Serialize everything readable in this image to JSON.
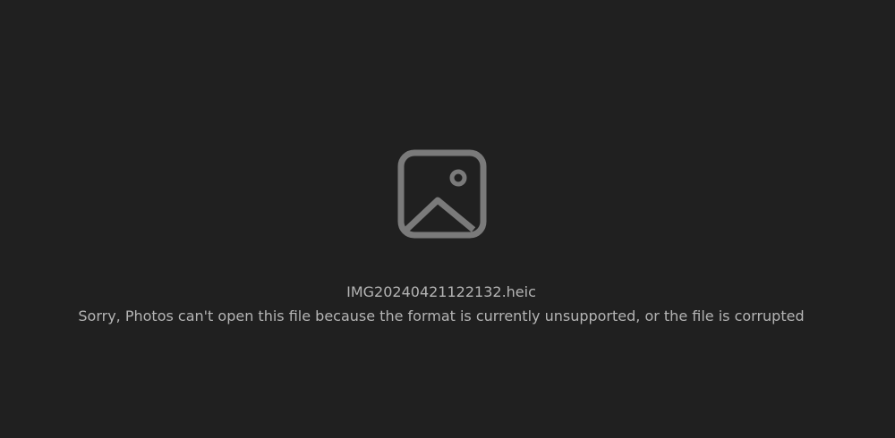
{
  "viewer": {
    "icon": "image-placeholder-icon",
    "filename": "IMG20240421122132.heic",
    "message": "Sorry, Photos can't open this file because the format is currently unsupported, or the file is corrupted"
  },
  "colors": {
    "background": "#202020",
    "icon": "#7a7a7a",
    "text": "#b4b4b4"
  }
}
